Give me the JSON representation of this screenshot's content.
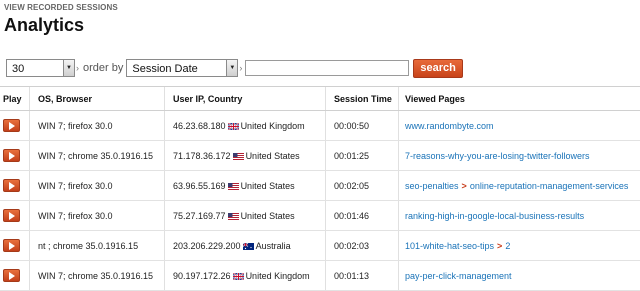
{
  "header": {
    "breadcrumb": "VIEW RECORDED SESSIONS",
    "title": "Analytics"
  },
  "toolbar": {
    "count_value": "30",
    "order_label": "order by",
    "order_value": "Session Date",
    "search_value": "",
    "search_label": "search"
  },
  "table": {
    "columns": [
      "Play",
      "OS, Browser",
      "User IP, Country",
      "Session Time",
      "Viewed Pages"
    ],
    "rows": [
      {
        "os": "WIN 7; firefox 30.0",
        "ip": "46.23.68.180",
        "flag": "uk-flag-icon",
        "country": "United Kingdom",
        "time": "00:00:50",
        "pages": [
          "www.randombyte.com"
        ]
      },
      {
        "os": "WIN 7; chrome 35.0.1916.15",
        "ip": "71.178.36.172",
        "flag": "us-flag-icon",
        "country": "United States",
        "time": "00:01:25",
        "pages": [
          "7-reasons-why-you-are-losing-twitter-followers"
        ]
      },
      {
        "os": "WIN 7; firefox 30.0",
        "ip": "63.96.55.169",
        "flag": "us-flag-icon",
        "country": "United States",
        "time": "00:02:05",
        "pages": [
          "seo-penalties",
          "online-reputation-management-services"
        ]
      },
      {
        "os": "WIN 7; firefox 30.0",
        "ip": "75.27.169.77",
        "flag": "us-flag-icon",
        "country": "United States",
        "time": "00:01:46",
        "pages": [
          "ranking-high-in-google-local-business-results"
        ]
      },
      {
        "os": "nt ; chrome 35.0.1916.15",
        "ip": "203.206.229.200",
        "flag": "au-flag-icon",
        "country": "Australia",
        "time": "00:02:03",
        "pages": [
          "101-white-hat-seo-tips",
          "2"
        ]
      },
      {
        "os": "WIN 7; chrome 35.0.1916.15",
        "ip": "90.197.172.26",
        "flag": "uk-flag-icon",
        "country": "United Kingdom",
        "time": "00:01:13",
        "pages": [
          "pay-per-click-management"
        ]
      }
    ]
  },
  "colors": {
    "accent": "#d2522a",
    "link": "#1a73b8"
  }
}
